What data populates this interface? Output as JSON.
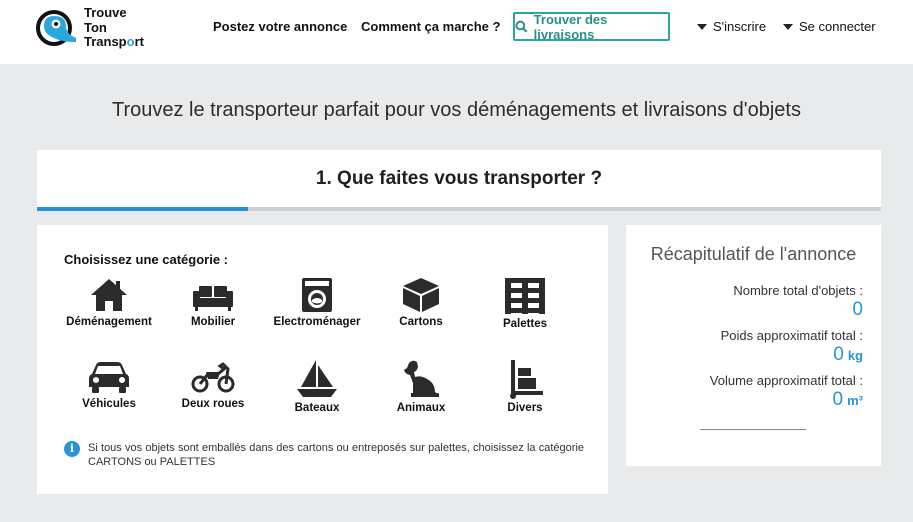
{
  "header": {
    "logo_lines": [
      "Trouve",
      "Ton",
      "Transp",
      "o",
      "rt"
    ],
    "nav": {
      "post_ad": "Postez votre annonce",
      "how_it_works": "Comment ça marche ?",
      "find_deliveries": "Trouver des livraisons",
      "signup": "S'inscrire",
      "login": "Se connecter"
    }
  },
  "main_title": "Trouvez le transporteur parfait pour vos déménagements et livraisons d'objets",
  "step": {
    "title": "1. Que faites vous transporter ?",
    "progress": 0.25
  },
  "categories": {
    "heading": "Choisissez une catégorie :",
    "items": [
      {
        "label": "Déménagement",
        "icon": "house-icon"
      },
      {
        "label": "Mobilier",
        "icon": "sofa-icon"
      },
      {
        "label": "Electroménager",
        "icon": "washing-machine-icon"
      },
      {
        "label": "Cartons",
        "icon": "box-icon"
      },
      {
        "label": "Palettes",
        "icon": "pallet-icon"
      },
      {
        "label": "Véhicules",
        "icon": "car-icon"
      },
      {
        "label": "Deux roues",
        "icon": "motorcycle-icon"
      },
      {
        "label": "Bateaux",
        "icon": "sailboat-icon"
      },
      {
        "label": "Animaux",
        "icon": "dog-icon"
      },
      {
        "label": "Divers",
        "icon": "hand-truck-icon"
      }
    ],
    "info": "Si tous vos objets sont emballés dans des cartons ou entreposés sur palettes, choisissez la catégorie CARTONS ou PALETTES"
  },
  "summary": {
    "title": "Récapitulatif de l'annonce",
    "objects_label": "Nombre total d'objets :",
    "objects_value": "0",
    "weight_label": "Poids approximatif total :",
    "weight_value": "0",
    "weight_unit": "kg",
    "volume_label": "Volume approximatif total :",
    "volume_value": "0",
    "volume_unit": "m³"
  },
  "colors": {
    "accent_blue": "#2a93d5",
    "teal": "#2ea4a0",
    "background": "#e9eaec"
  }
}
